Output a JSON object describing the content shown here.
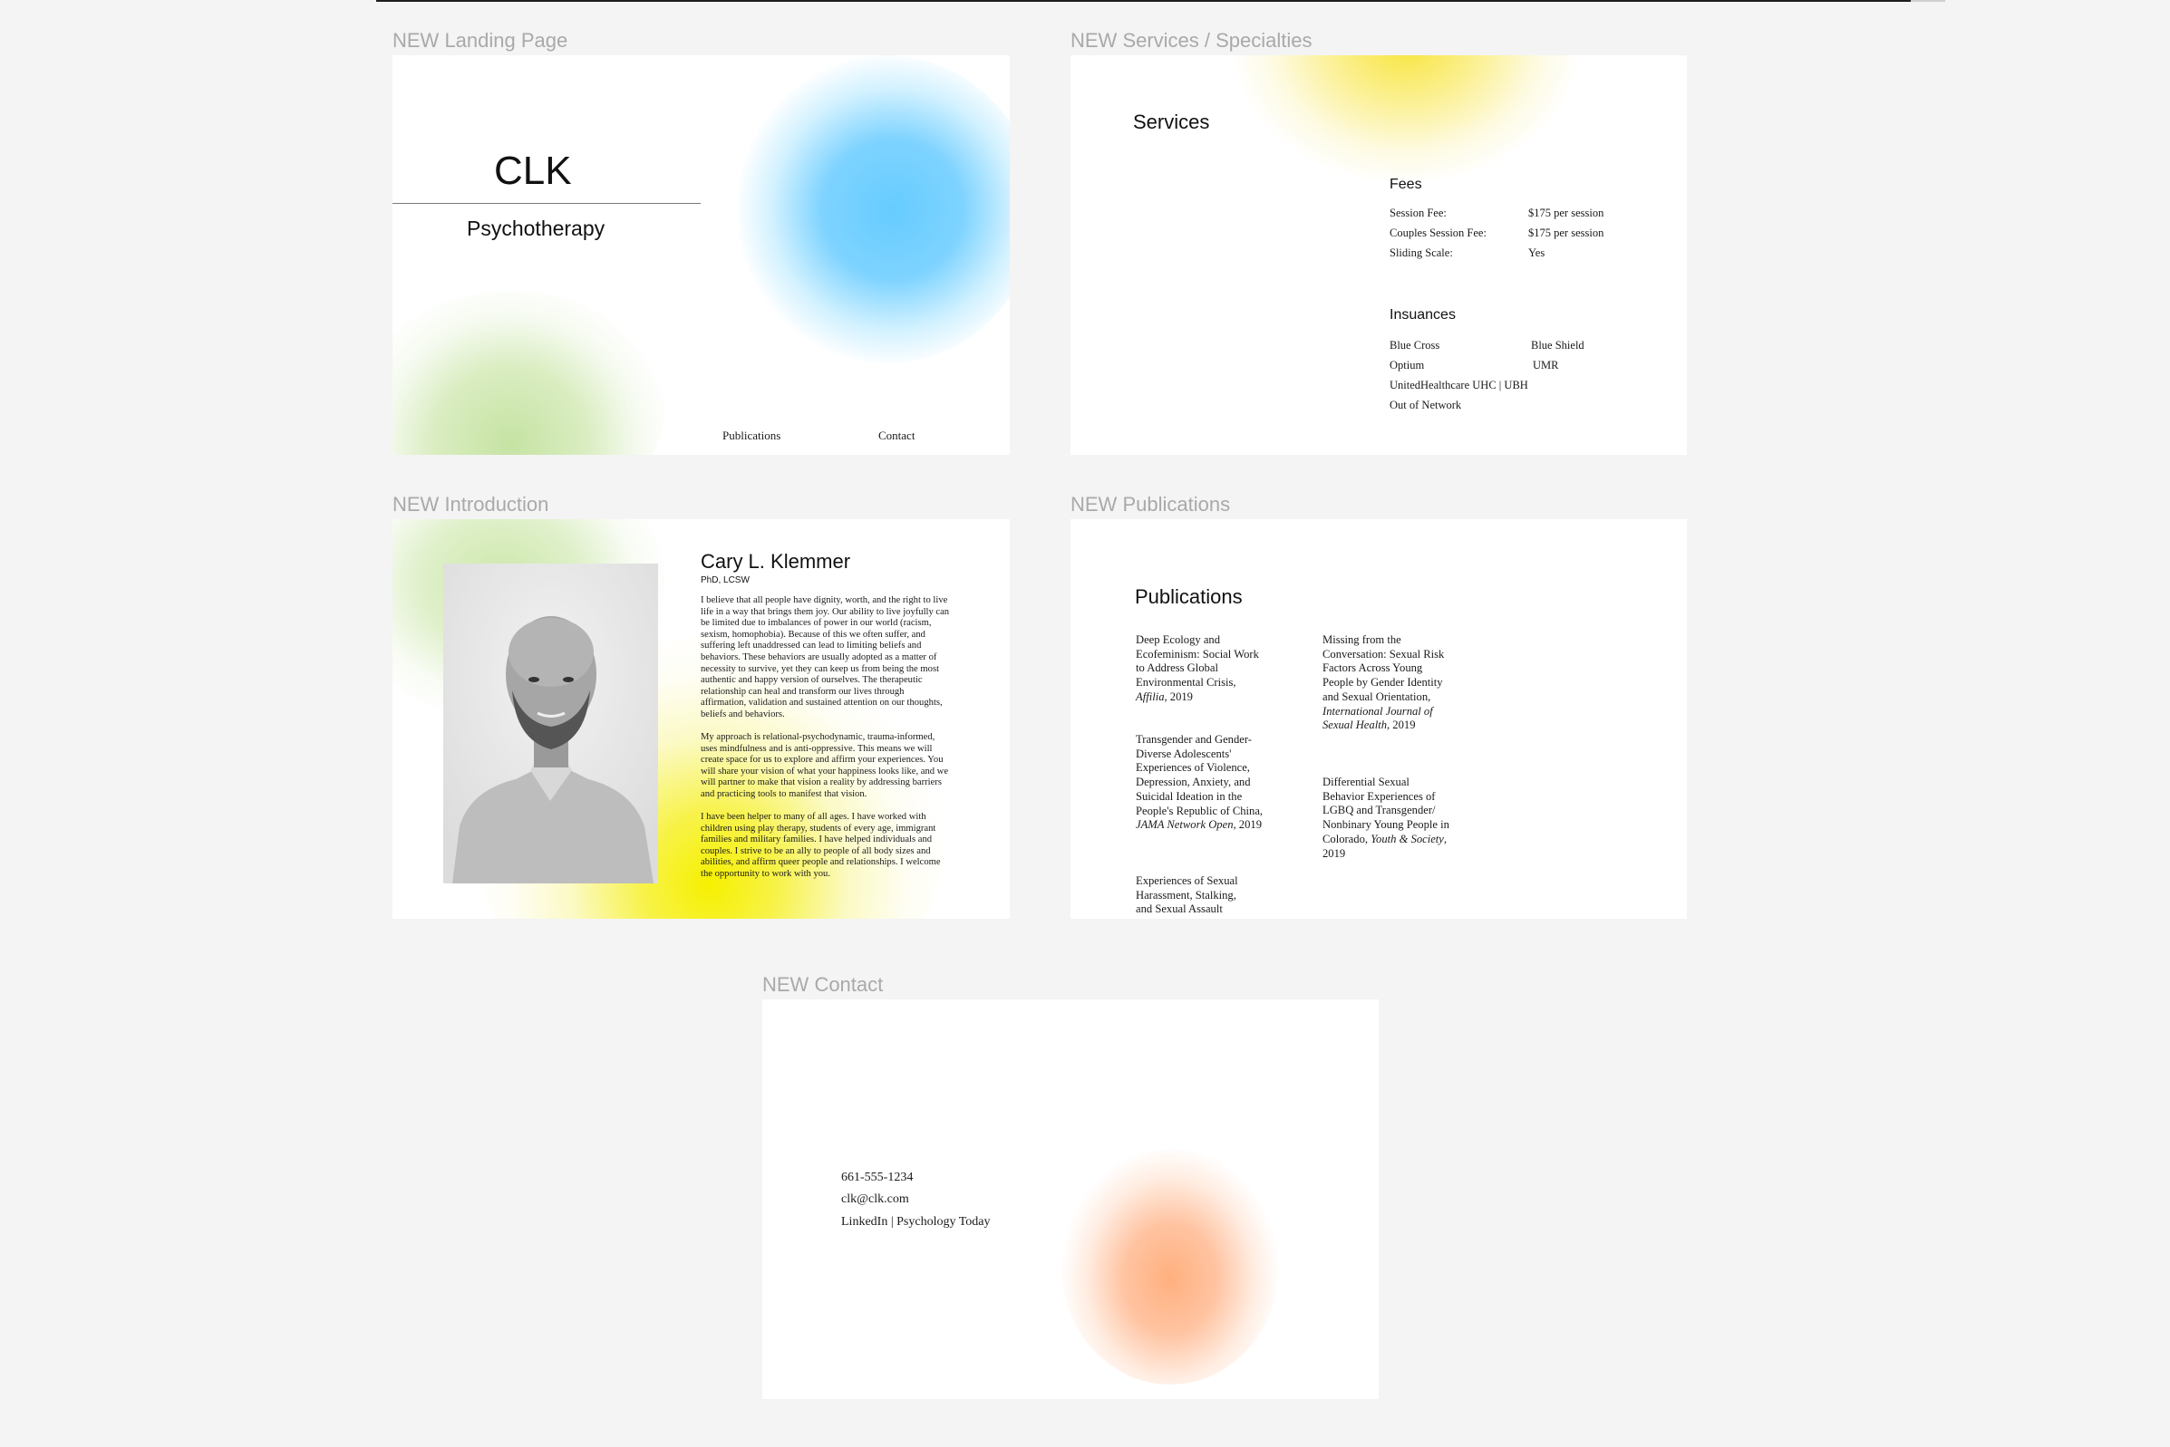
{
  "frames": {
    "landing": {
      "label": "NEW Landing Page",
      "title": "CLK",
      "subtitle": "Psychotherapy",
      "nav": [
        "Publications",
        "Contact"
      ]
    },
    "services": {
      "label": "NEW Services / Specialties",
      "title": "Services",
      "fees_heading": "Fees",
      "fees": [
        {
          "label": "Session Fee:",
          "value": "$175 per session"
        },
        {
          "label": "Couples Session Fee:",
          "value": "$175 per session"
        },
        {
          "label": "Sliding Scale:",
          "value": "Yes"
        }
      ],
      "insurance_heading": "Insuances",
      "insurances": [
        [
          "Blue Cross",
          "Blue Shield"
        ],
        [
          "Optium",
          "UMR"
        ],
        [
          "UnitedHealthcare UHC | UBH",
          ""
        ],
        [
          "Out of Network",
          ""
        ]
      ]
    },
    "introduction": {
      "label": "NEW Introduction",
      "name": "Cary L. Klemmer",
      "credentials": "PhD, LCSW",
      "paragraphs": [
        "I believe that all people have dignity, worth, and the right to live life in a way that brings them joy. Our ability to live joyfully can be limited due to imbalances of power in our world (racism, sexism, homophobia). Because of this we often suffer, and suffering left unaddressed can lead to limiting beliefs and behaviors. These behaviors are usually adopted as a matter of necessity to survive, yet they can keep us from being the most authentic and happy version of ourselves. The therapeutic relationship can heal and transform our lives through affirmation, validation and sustained attention on our thoughts, beliefs and behaviors.",
        "My approach is relational-psychodynamic, trauma-informed, uses mindfulness and is anti-oppressive. This means we will create space for us to explore and affirm your experiences. You will share your vision of what your happiness looks like, and we will partner to make that vision a reality by addressing barriers and practicing tools to manifest that vision.",
        "I have been helper to many of all ages. I have worked with children using play therapy, students of every age, immigrant families and military families. I have helped individuals and couples. I strive to be an ally to people of all body sizes and abilities, and affirm queer people and relationships. I welcome the opportunity to work with you."
      ]
    },
    "publications": {
      "label": "NEW Publications",
      "title": "Publications",
      "items": [
        {
          "title": "Deep Ecology and Ecofeminism: Social Work to Address Global Environmental Crisis,",
          "journal": "Affilia",
          "year": ", 2019"
        },
        {
          "title": "Missing from the Conversation: Sexual Risk Factors Across Young People by Gender Identity and Sexual Orientation,",
          "journal": "International Journal of Sexual Health",
          "year": ", 2019"
        },
        {
          "title": "Transgender and Gender-Diverse Adolescents' Experiences of Violence, Depression, Anxiety, and Suicidal Ideation in the People's Republic of China,",
          "journal": "JAMA Network Open",
          "year": ", 2019"
        },
        {
          "title": "Differential Sexual Behavior Experiences of LGBQ and Transgender/ Nonbinary Young People in Colorado,",
          "journal": "Youth & Society",
          "year": ", 2019"
        },
        {
          "title": "Experiences of Sexual Harassment, Stalking, and Sexual Assault",
          "journal": "",
          "year": ""
        }
      ]
    },
    "contact": {
      "label": "NEW Contact",
      "phone": "661-555-1234",
      "email": "clk@clk.com",
      "links": "LinkedIn | Psychology Today"
    }
  },
  "colors": {
    "canvas": "#f4f4f4",
    "blue_blob": "#66ccff",
    "green_blob": "#c6e3a3",
    "yellow_blob": "#f6f000",
    "orange_blob": "#ffb07e"
  }
}
